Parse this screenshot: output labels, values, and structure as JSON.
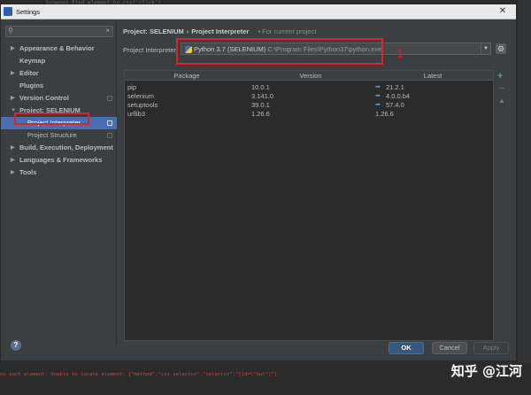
{
  "window": {
    "title": "Settings"
  },
  "background": {
    "top_code": "browser.find_element_by_css('click')",
    "error_line": "no such element: Unable to locate element: {\"method\":\"css selector\",\"selector\":\"[id=\\\"kw\\\"]\"}",
    "watermark": "知乎 @江河"
  },
  "sidebar": {
    "search_placeholder": "",
    "items": [
      {
        "label": "Appearance & Behavior",
        "arrow": "▶"
      },
      {
        "label": "Keymap",
        "arrow": ""
      },
      {
        "label": "Editor",
        "arrow": "▶"
      },
      {
        "label": "Plugins",
        "arrow": ""
      },
      {
        "label": "Version Control",
        "arrow": "▶"
      },
      {
        "label": "Project: SELENIUM",
        "arrow": "▼"
      },
      {
        "label": "Project Interpreter",
        "arrow": ""
      },
      {
        "label": "Project Structure",
        "arrow": ""
      },
      {
        "label": "Build, Execution, Deployment",
        "arrow": "▶"
      },
      {
        "label": "Languages & Frameworks",
        "arrow": "▶"
      },
      {
        "label": "Tools",
        "arrow": "▶"
      }
    ]
  },
  "main": {
    "breadcrumb": {
      "root": "Project: SELENIUM",
      "sep": "›",
      "page": "Project Interpreter",
      "note": "For current project"
    },
    "interpreter": {
      "label": "Project Interpreter:",
      "name": "Python 3.7 (SELENIUM)",
      "path": "C:\\Program Files\\Python37\\python.exe"
    },
    "annotation_number": "1",
    "table": {
      "headers": [
        "Package",
        "Version",
        "Latest"
      ],
      "rows": [
        {
          "package": "pip",
          "version": "10.0.1",
          "latest": "21.2.1",
          "update": true
        },
        {
          "package": "selenium",
          "version": "3.141.0",
          "latest": "4.0.0.b4",
          "update": true
        },
        {
          "package": "setuptools",
          "version": "39.0.1",
          "latest": "57.4.0",
          "update": true
        },
        {
          "package": "urllib3",
          "version": "1.26.6",
          "latest": "1.26.6",
          "update": false
        }
      ]
    }
  },
  "footer": {
    "help": "?",
    "ok": "OK",
    "cancel": "Cancel",
    "apply": "Apply"
  },
  "colors": {
    "accent": "#4b6eaf",
    "annotation": "#d9232e",
    "update_arrow": "#4a9fd8",
    "add": "#4caf50"
  }
}
